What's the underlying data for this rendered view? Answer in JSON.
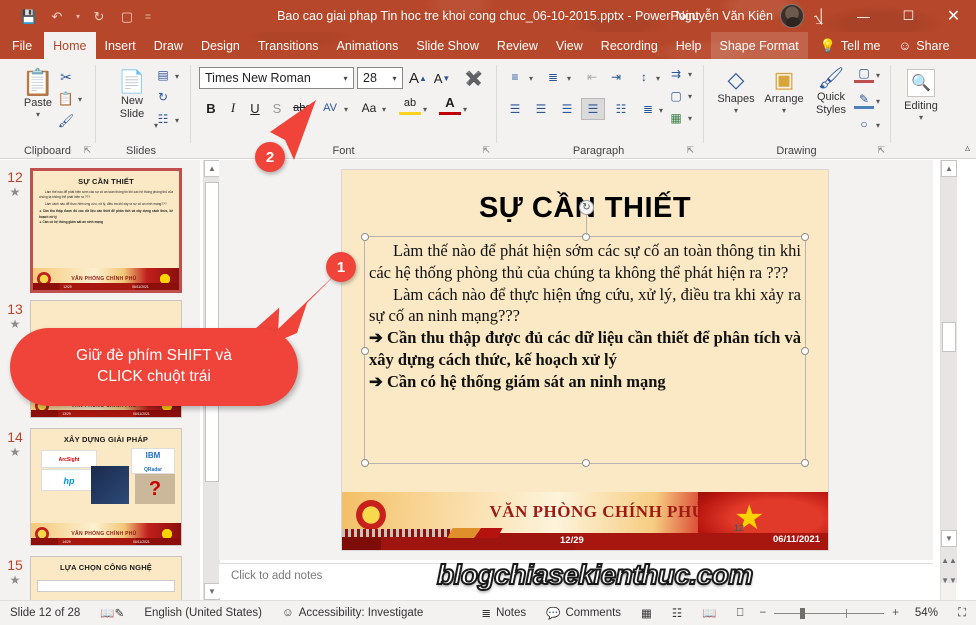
{
  "titlebar": {
    "document_title": "Bao cao giai phap Tin hoc tre khoi cong chuc_06-10-2015.pptx  -  PowerPoint",
    "account_name": "Nguyễn Văn Kiên",
    "qat": [
      {
        "name": "save-icon",
        "glyph": "ὋE"
      },
      {
        "name": "undo-icon",
        "glyph": "↺"
      },
      {
        "name": "redo-icon",
        "glyph": "↻"
      },
      {
        "name": "start-presentation-icon",
        "glyph": "▣"
      },
      {
        "name": "customize-qat-icon",
        "glyph": "▾"
      }
    ],
    "window_buttons": {
      "ribbon_display_options": "⎙",
      "minimize": "—",
      "maximize": "☐",
      "close": "✕"
    }
  },
  "tabs": [
    {
      "label": "File",
      "state": "file"
    },
    {
      "label": "Home",
      "state": "active"
    },
    {
      "label": "Insert",
      "state": "normal"
    },
    {
      "label": "Draw",
      "state": "normal"
    },
    {
      "label": "Design",
      "state": "normal"
    },
    {
      "label": "Transitions",
      "state": "normal"
    },
    {
      "label": "Animations",
      "state": "normal"
    },
    {
      "label": "Slide Show",
      "state": "normal"
    },
    {
      "label": "Review",
      "state": "normal"
    },
    {
      "label": "View",
      "state": "normal"
    },
    {
      "label": "Recording",
      "state": "normal"
    },
    {
      "label": "Help",
      "state": "normal"
    },
    {
      "label": "Shape Format",
      "state": "contextual"
    }
  ],
  "tellme": {
    "label": "Tell me",
    "icon": "lightbulb-icon"
  },
  "share": {
    "label": "Share",
    "icon": "share-person-icon"
  },
  "ribbon": {
    "groups": [
      {
        "name": "Clipboard",
        "label": "Clipboard"
      },
      {
        "name": "Slides",
        "label": "Slides"
      },
      {
        "name": "Font",
        "label": "Font"
      },
      {
        "name": "Paragraph",
        "label": "Paragraph"
      },
      {
        "name": "Drawing",
        "label": "Drawing"
      }
    ],
    "clipboard": {
      "paste_label": "Paste"
    },
    "slides": {
      "new_slide_label": "New\nSlide",
      "new_slide_line1": "New",
      "new_slide_line2": "Slide"
    },
    "font": {
      "font_name": "Times New Roman",
      "font_size": "28",
      "bold": "B",
      "italic": "I",
      "underline": "U",
      "shadow": "S",
      "strikethrough": "abc",
      "char_spacing": "AV",
      "change_case": "Aa",
      "highlight": "ab",
      "font_color": "A",
      "grow": "A",
      "shrink": "A",
      "clear_fmt": "A"
    },
    "drawing": {
      "shapes_label": "Shapes",
      "arrange_label": "Arrange",
      "quick_styles_line1": "Quick",
      "quick_styles_line2": "Styles"
    },
    "editing": {
      "label": "Editing",
      "icon": "magnifier-icon"
    }
  },
  "thumbnails": [
    {
      "number": "12",
      "selected": true,
      "title": "SỰ CẦN THIẾT",
      "lines": [
        "Làm thế nào để phát hiện sớm các sự cố an toàn thông tin khi các hệ thống phòng thủ của chúng ta không thể phát hiện ra ???",
        "Làm cách nào để thực hiện ứng cứu, xử lý, điều tra khi xảy ra sự cố an ninh mạng???",
        "➔ Cần thu thập được đủ các dữ liệu cần thiết để phân tích và xây dựng cách thức, kế hoạch xử lý",
        "➔ Cần có hệ thống giám sát an ninh mạng"
      ],
      "footer": "VĂN PHÒNG CHÍNH PHỦ"
    },
    {
      "number": "13",
      "selected": false,
      "title": "",
      "lines": [],
      "footer": "VĂN PHÒNG CHÍNH PHỦ"
    },
    {
      "number": "14",
      "selected": false,
      "title": "XÂY DỰNG GIẢI PHÁP",
      "lines": [],
      "footer": "VĂN PHÒNG CHÍNH PHỦ",
      "logos": [
        "ArcSight",
        "hp",
        "IBM QRadar",
        "?"
      ]
    },
    {
      "number": "15",
      "selected": false,
      "title": "LỰA CHỌN CÔNG NGHỆ",
      "lines": [],
      "footer": ""
    }
  ],
  "slide": {
    "title": "SỰ CẦN THIẾT",
    "paragraphs": [
      {
        "style": "normal",
        "text": "Làm thế nào để phát hiện sớm các sự cố an toàn thông tin khi các hệ thống phòng thủ của chúng ta không thể phát hiện ra ???"
      },
      {
        "style": "normal",
        "text": "Làm cách nào để thực hiện ứng cứu, xử lý, điều tra khi xảy ra sự cố an ninh mạng???"
      },
      {
        "style": "arrow",
        "text": "➔ Cần thu thập được đủ các dữ liệu cần thiết để phân tích và xây dựng cách thức, kế hoạch xử lý"
      },
      {
        "style": "arrow",
        "text": "➔ Cần có hệ thống giám sát an ninh mạng"
      }
    ],
    "footer": {
      "org_name": "VĂN PHÒNG CHÍNH PHỦ",
      "page_counter": "12/29",
      "slide_number": "12",
      "date": "06/11/2021"
    }
  },
  "notes": {
    "placeholder": "Click to add notes"
  },
  "statusbar": {
    "slide_counter": "Slide 12 of 28",
    "language": "English (United States)",
    "accessibility": "Accessibility: Investigate",
    "notes_label": "Notes",
    "comments_label": "Comments",
    "zoom_level": "54%",
    "view_buttons": [
      "normal-view",
      "slide-sorter-view",
      "reading-view",
      "slide-show-view"
    ],
    "zoom_out": "−",
    "zoom_in": "+",
    "fit_slide": "⛶"
  },
  "annotations": {
    "callout_line1": "Giữ đè phím SHIFT và",
    "callout_line2": "CLICK chuột trái",
    "badge_1": "1",
    "badge_2": "2",
    "accent_color": "#f0443a"
  },
  "watermark": {
    "text": "blogchiasekienthuc.com"
  }
}
